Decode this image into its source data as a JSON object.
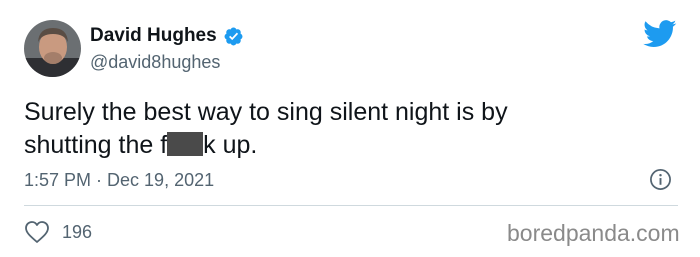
{
  "author": {
    "display_name": "David Hughes",
    "handle": "@david8hughes",
    "verified": true
  },
  "tweet": {
    "line1": "Surely the best way to sing silent night is by",
    "line2_start": "shutting the f",
    "line2_end": "k up.",
    "timestamp": "1:57 PM · Dec 19, 2021"
  },
  "engagement": {
    "likes": "196"
  },
  "watermark": "boredpanda.com",
  "colors": {
    "brand_blue": "#1d9bf0",
    "text_primary": "#0f1419",
    "text_secondary": "#536471"
  },
  "icons": {
    "logo": "twitter-bird-icon",
    "verified": "verified-badge-icon",
    "info": "info-icon",
    "like": "heart-icon"
  }
}
